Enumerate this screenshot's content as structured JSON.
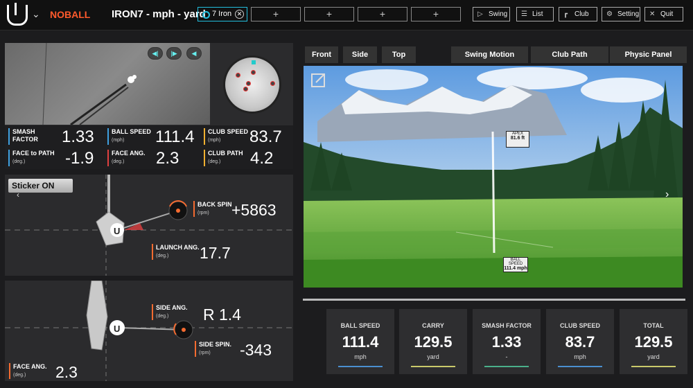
{
  "header": {
    "noball": "NOBALL",
    "club_info": "IRON7 - mph - yard",
    "active_club": "7 Iron",
    "slots": [
      "+",
      "+",
      "+",
      "+"
    ],
    "nav": [
      {
        "label": "Swing",
        "icon": "play-circle-icon"
      },
      {
        "label": "List",
        "icon": "list-icon"
      },
      {
        "label": "Club",
        "icon": "club-icon"
      },
      {
        "label": "Setting",
        "icon": "gear-icon"
      },
      {
        "label": "Quit",
        "icon": "close-icon"
      }
    ]
  },
  "stats": {
    "smash_factor": {
      "label1": "SMASH",
      "label2": "FACTOR",
      "value": "1.33",
      "color": "#3fa0e0"
    },
    "ball_speed": {
      "label": "BALL SPEED",
      "unit": "(mph)",
      "value": "111.4",
      "color": "#3fa0e0"
    },
    "club_speed": {
      "label": "CLUB SPEED",
      "unit": "(mph)",
      "value": "83.7",
      "color": "#f0b030"
    },
    "face_to_path": {
      "label": "FACE to PATH",
      "unit": "(deg.)",
      "value": "-1.9",
      "color": "#3fa0e0"
    },
    "face_ang": {
      "label": "FACE ANG.",
      "unit": "(deg.)",
      "value": "2.3",
      "color": "#e04040"
    },
    "club_path": {
      "label": "CLUB PATH",
      "unit": "(deg.)",
      "value": "4.2",
      "color": "#f0b030"
    }
  },
  "side_view": {
    "sticker": "Sticker ON",
    "back_spin": {
      "label": "BACK SPIN",
      "unit": "(rpm)",
      "value": "+5863"
    },
    "launch_ang": {
      "label": "LAUNCH ANG.",
      "unit": "(deg.)",
      "value": "17.7"
    }
  },
  "top_view": {
    "side_ang": {
      "label": "SIDE ANG.",
      "unit": "(deg.)",
      "value": "R 1.4"
    },
    "side_spin": {
      "label": "SIDE SPIN.",
      "unit": "(rpm)",
      "value": "-343"
    },
    "face_ang": {
      "label": "FACE ANG.",
      "unit": "(deg.)",
      "value": "2.3"
    }
  },
  "view_tabs": [
    "Front",
    "Side",
    "Top"
  ],
  "panel_tabs": [
    "Swing Motion",
    "Club Path",
    "Physic Panel"
  ],
  "scene": {
    "apex_label": "APEX",
    "apex_value": "81.6 ft",
    "ball_speed_label": "BALL SPEED",
    "ball_speed_value": "111.4 mph"
  },
  "summary": [
    {
      "label": "BALL SPEED",
      "value": "111.4",
      "unit": "mph",
      "color": "#4a8fd0"
    },
    {
      "label": "CARRY",
      "value": "129.5",
      "unit": "yard",
      "color": "#c9c96a"
    },
    {
      "label": "SMASH FACTOR",
      "value": "1.33",
      "unit": "-",
      "color": "#4ab08a"
    },
    {
      "label": "CLUB SPEED",
      "value": "83.7",
      "unit": "mph",
      "color": "#4a8fd0"
    },
    {
      "label": "TOTAL",
      "value": "129.5",
      "unit": "yard",
      "color": "#c9c96a"
    }
  ]
}
